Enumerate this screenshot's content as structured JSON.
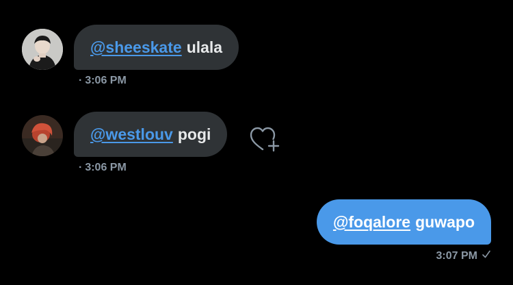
{
  "messages": [
    {
      "direction": "incoming",
      "mention": "@sheeskate",
      "text": "ulala",
      "time": "3:06 PM",
      "avatar": "user-avatar-1"
    },
    {
      "direction": "incoming",
      "mention": "@westlouv",
      "text": "pogi",
      "time": "3:06 PM",
      "avatar": "user-avatar-2",
      "reaction_icon": "add-reaction-heart-icon"
    },
    {
      "direction": "outgoing",
      "mention": "@foqalore",
      "text": "guwapo",
      "time": "3:07 PM",
      "status_icon": "sent-check-icon"
    }
  ],
  "separator": "·",
  "colors": {
    "background": "#000000",
    "incoming_bubble": "#2f3336",
    "outgoing_bubble": "#4a99e9",
    "mention": "#4a99e9",
    "timestamp": "#8b98a5"
  }
}
